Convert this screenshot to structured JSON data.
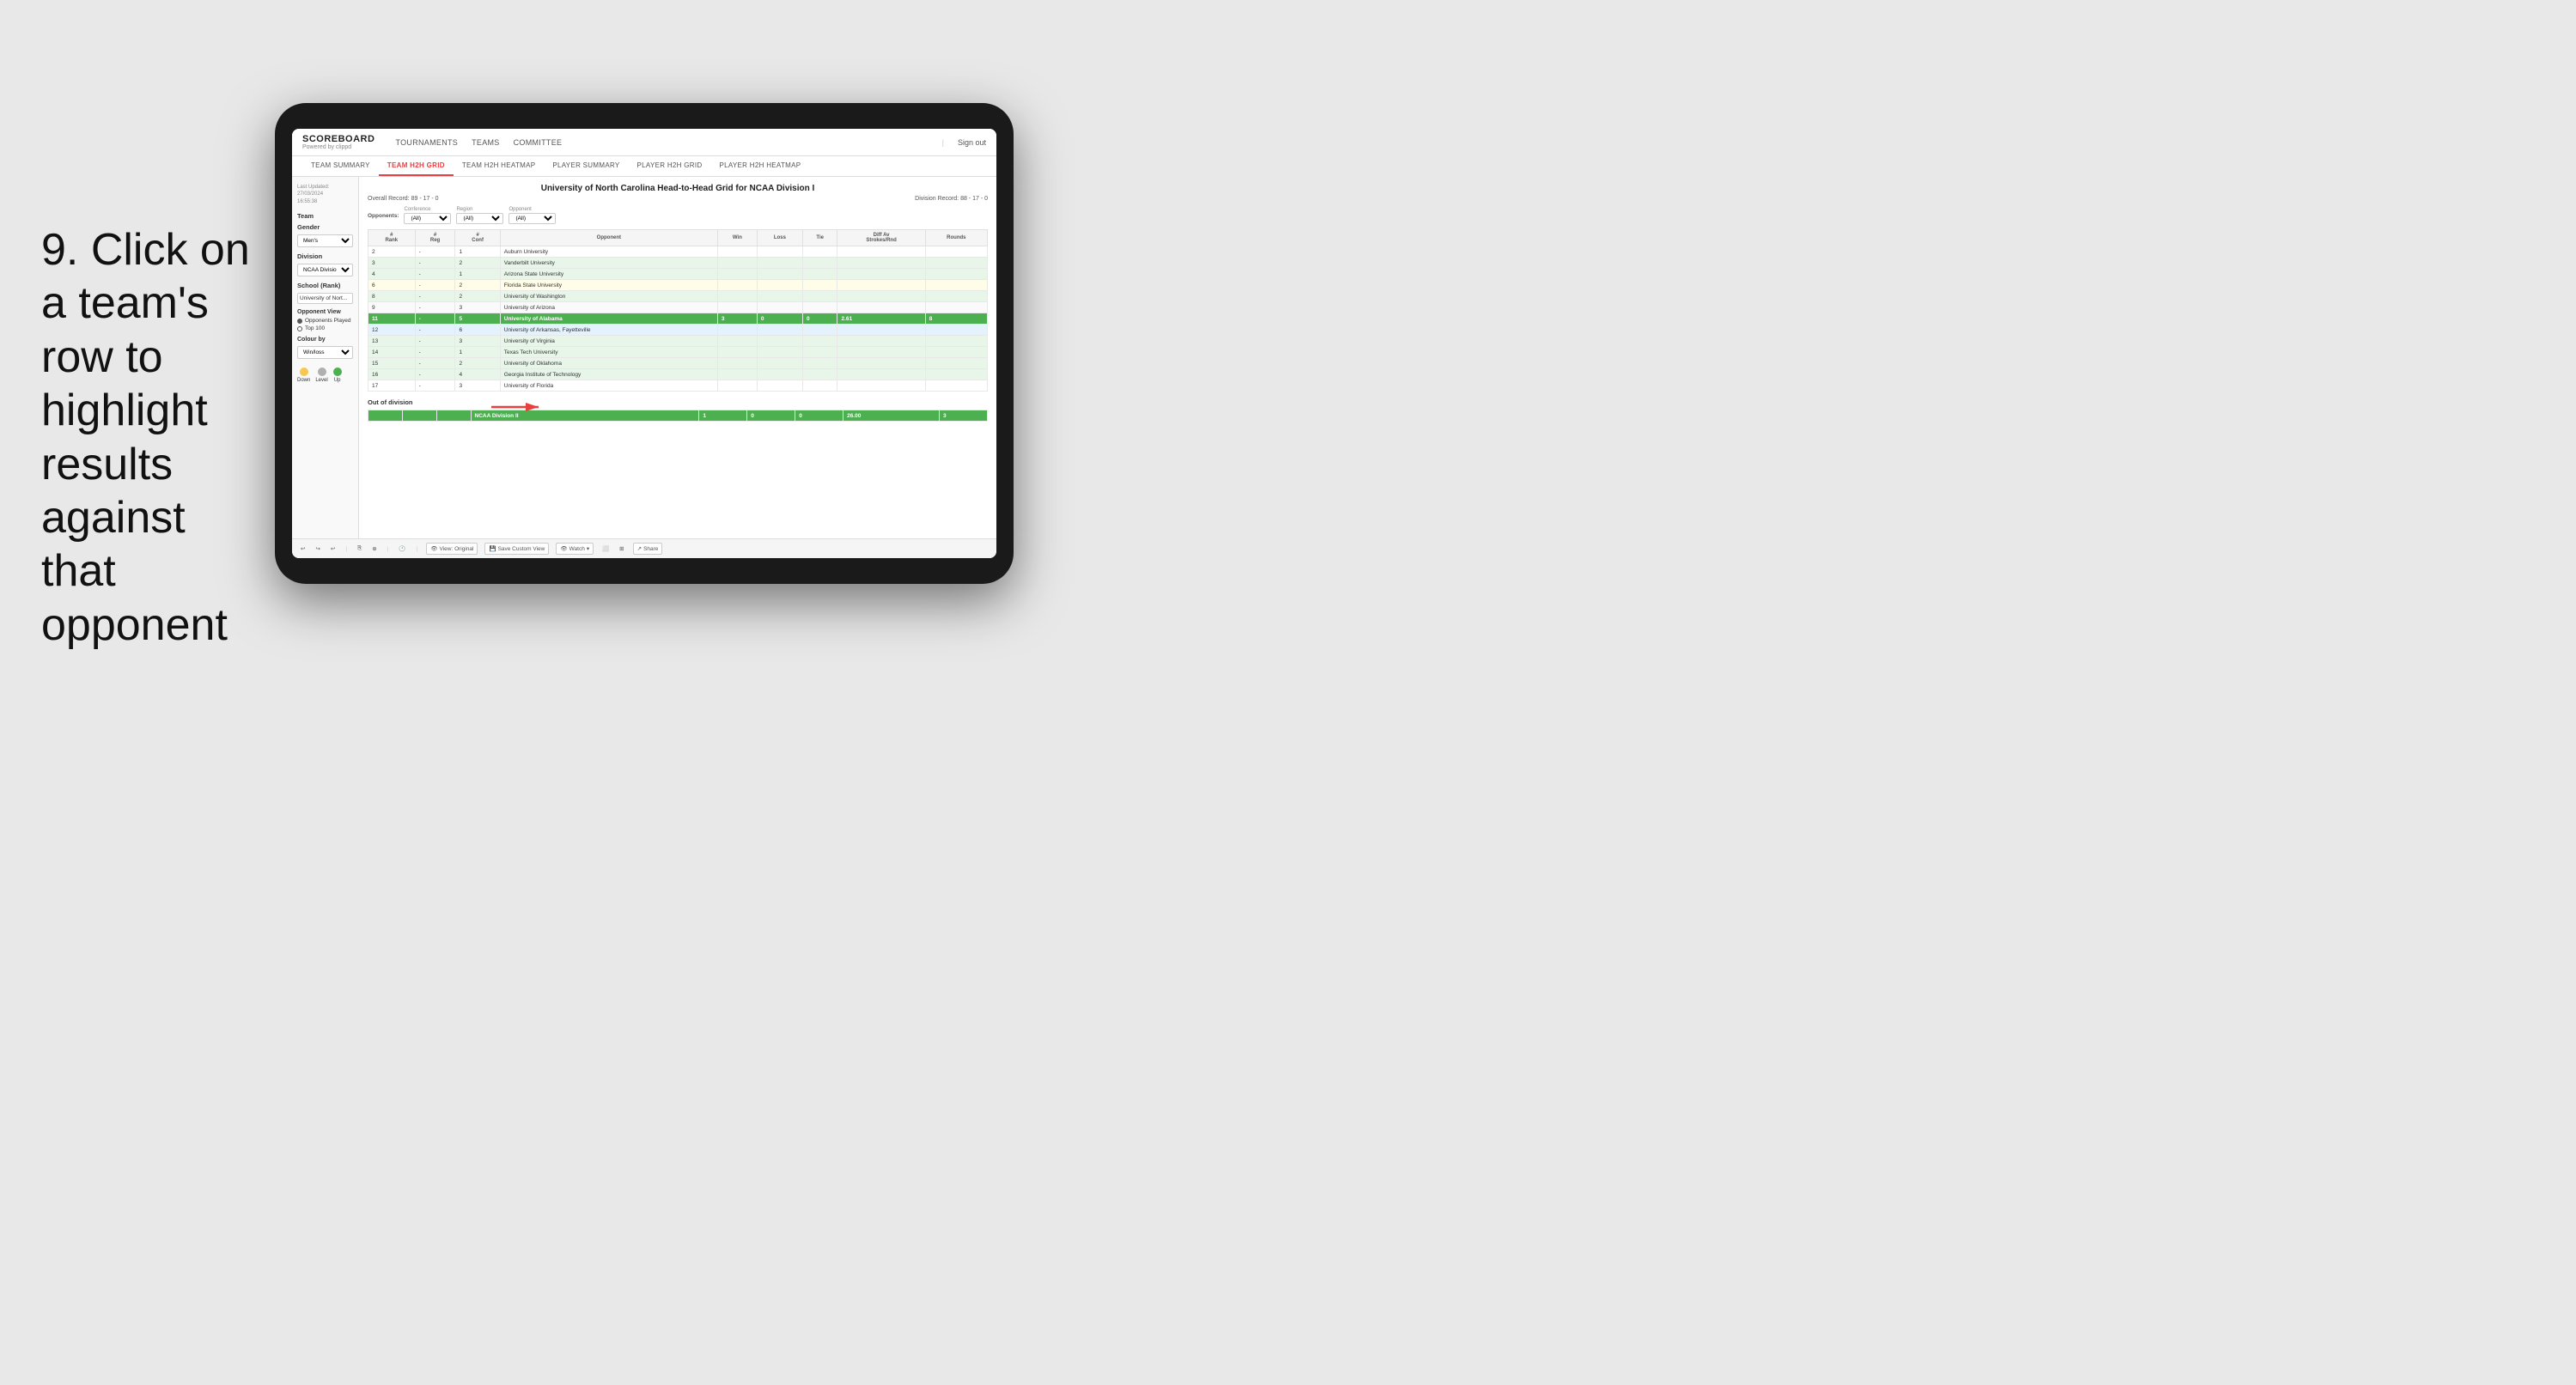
{
  "instruction": {
    "text": "9. Click on a team's row to highlight results against that opponent"
  },
  "nav": {
    "logo_title": "SCOREBOARD",
    "logo_sub": "Powered by clippd",
    "links": [
      "TOURNAMENTS",
      "TEAMS",
      "COMMITTEE"
    ],
    "sign_out": "Sign out"
  },
  "sub_nav": {
    "items": [
      "TEAM SUMMARY",
      "TEAM H2H GRID",
      "TEAM H2H HEATMAP",
      "PLAYER SUMMARY",
      "PLAYER H2H GRID",
      "PLAYER H2H HEATMAP"
    ],
    "active": "TEAM H2H GRID"
  },
  "sidebar": {
    "last_updated_label": "Last Updated: 27/03/2024",
    "time": "16:55:38",
    "team_label": "Team",
    "gender_label": "Gender",
    "gender_value": "Men's",
    "division_label": "Division",
    "division_value": "NCAA Division I",
    "school_label": "School (Rank)",
    "school_value": "University of Nort...",
    "opponent_view_label": "Opponent View",
    "opponents_played": "Opponents Played",
    "top100": "Top 100",
    "colour_by_label": "Colour by",
    "colour_by_value": "Win/loss",
    "legend": [
      {
        "label": "Down",
        "color": "#f9c74f"
      },
      {
        "label": "Level",
        "color": "#b0b0b0"
      },
      {
        "label": "Up",
        "color": "#4caf50"
      }
    ]
  },
  "grid": {
    "title": "University of North Carolina Head-to-Head Grid for NCAA Division I",
    "overall_record_label": "Overall Record:",
    "overall_record": "89 - 17 - 0",
    "division_record_label": "Division Record:",
    "division_record": "88 - 17 - 0",
    "filters": {
      "opponents_label": "Opponents:",
      "conference_label": "Conference",
      "conference_value": "(All)",
      "region_label": "Region",
      "region_value": "(All)",
      "opponent_label": "Opponent",
      "opponent_value": "(All)"
    },
    "columns": [
      "#\nRank",
      "#\nReg",
      "#\nConf",
      "Opponent",
      "Win",
      "Loss",
      "Tie",
      "Diff Av\nStrokes/Rnd",
      "Rounds"
    ],
    "rows": [
      {
        "rank": "2",
        "reg": "-",
        "conf": "1",
        "opponent": "Auburn University",
        "win": "",
        "loss": "",
        "tie": "",
        "diff": "",
        "rounds": "",
        "style": "normal"
      },
      {
        "rank": "3",
        "reg": "-",
        "conf": "2",
        "opponent": "Vanderbilt University",
        "win": "",
        "loss": "",
        "tie": "",
        "diff": "",
        "rounds": "",
        "style": "light-green"
      },
      {
        "rank": "4",
        "reg": "-",
        "conf": "1",
        "opponent": "Arizona State University",
        "win": "",
        "loss": "",
        "tie": "",
        "diff": "",
        "rounds": "",
        "style": "light-green"
      },
      {
        "rank": "6",
        "reg": "-",
        "conf": "2",
        "opponent": "Florida State University",
        "win": "",
        "loss": "",
        "tie": "",
        "diff": "",
        "rounds": "",
        "style": "light-yellow"
      },
      {
        "rank": "8",
        "reg": "-",
        "conf": "2",
        "opponent": "University of Washington",
        "win": "",
        "loss": "",
        "tie": "",
        "diff": "",
        "rounds": "",
        "style": "light-green"
      },
      {
        "rank": "9",
        "reg": "-",
        "conf": "3",
        "opponent": "University of Arizona",
        "win": "",
        "loss": "",
        "tie": "",
        "diff": "",
        "rounds": "",
        "style": "normal"
      },
      {
        "rank": "11",
        "reg": "-",
        "conf": "5",
        "opponent": "University of Alabama",
        "win": "3",
        "loss": "0",
        "tie": "0",
        "diff": "2.61",
        "rounds": "8",
        "style": "highlighted"
      },
      {
        "rank": "12",
        "reg": "-",
        "conf": "6",
        "opponent": "University of Arkansas, Fayetteville",
        "win": "",
        "loss": "",
        "tie": "",
        "diff": "",
        "rounds": "",
        "style": "light-blue"
      },
      {
        "rank": "13",
        "reg": "-",
        "conf": "3",
        "opponent": "University of Virginia",
        "win": "",
        "loss": "",
        "tie": "",
        "diff": "",
        "rounds": "",
        "style": "light-green"
      },
      {
        "rank": "14",
        "reg": "-",
        "conf": "1",
        "opponent": "Texas Tech University",
        "win": "",
        "loss": "",
        "tie": "",
        "diff": "",
        "rounds": "",
        "style": "light-green"
      },
      {
        "rank": "15",
        "reg": "-",
        "conf": "2",
        "opponent": "University of Oklahoma",
        "win": "",
        "loss": "",
        "tie": "",
        "diff": "",
        "rounds": "",
        "style": "light-green"
      },
      {
        "rank": "16",
        "reg": "-",
        "conf": "4",
        "opponent": "Georgia Institute of Technology",
        "win": "",
        "loss": "",
        "tie": "",
        "diff": "",
        "rounds": "",
        "style": "light-green"
      },
      {
        "rank": "17",
        "reg": "-",
        "conf": "3",
        "opponent": "University of Florida",
        "win": "",
        "loss": "",
        "tie": "",
        "diff": "",
        "rounds": "",
        "style": "normal"
      }
    ],
    "out_of_division_label": "Out of division",
    "out_row": {
      "label": "NCAA Division II",
      "win": "1",
      "loss": "0",
      "tie": "0",
      "diff": "26.00",
      "rounds": "3"
    }
  },
  "toolbar": {
    "view_label": "View: Original",
    "save_label": "Save Custom View",
    "watch_label": "Watch",
    "share_label": "Share"
  }
}
